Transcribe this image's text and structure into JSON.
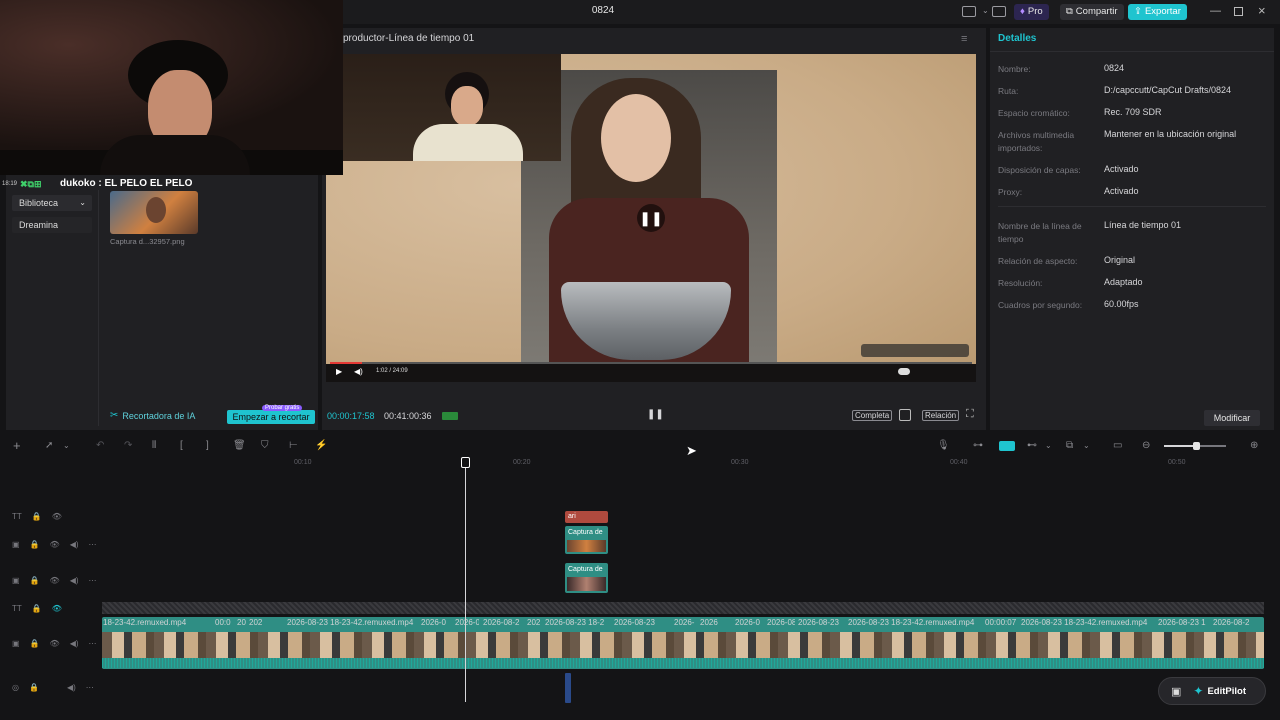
{
  "window_title": "0824",
  "top_actions": {
    "pro": "Pro",
    "share": "Compartir",
    "export": "Exportar"
  },
  "viewer": {
    "title": "productor-Línea de tiempo 01",
    "current_time": "00:00:17:58",
    "total_time": "00:41:00:36",
    "embedded_time": "1:02 / 24:09",
    "buttons": {
      "full": "Completa",
      "ratio": "Relación"
    }
  },
  "webcam_overlay": {
    "chat": "dukoko : EL PELO EL PELO",
    "time": "18:19"
  },
  "left_panel": {
    "nav": [
      "Biblioteca",
      "Dreamina"
    ],
    "media_caption": "Captura d...32957.png",
    "ai_cropper": "Recortadora de IA",
    "start_crop": "Empezar a recortar",
    "free_badge": "Probar gratis"
  },
  "details": {
    "tab": "Detalles",
    "rows": [
      {
        "label": "Nombre:",
        "value": "0824"
      },
      {
        "label": "Ruta:",
        "value": "D:/capccutt/CapCut Drafts/0824"
      },
      {
        "label": "Espacio cromático:",
        "value": "Rec. 709 SDR"
      },
      {
        "label": "Archivos multimedia importados:",
        "value": "Mantener en la ubicación original"
      },
      {
        "label": "Disposición de capas:",
        "value": "Activado"
      },
      {
        "label": "Proxy:",
        "value": "Activado"
      },
      {
        "label": "Nombre de la línea de tiempo",
        "value": "Línea de tiempo 01"
      },
      {
        "label": "Relación de aspecto:",
        "value": "Original"
      },
      {
        "label": "Resolución:",
        "value": "Adaptado"
      },
      {
        "label": "Cuadros por segundo:",
        "value": "60.00fps"
      }
    ],
    "modify": "Modificar"
  },
  "timeline": {
    "ticks": [
      "00:10",
      "00:20",
      "00:30",
      "00:40",
      "00:50"
    ],
    "small_clips": {
      "text": "ari",
      "capture1": "Captura de",
      "capture2": "Captura de"
    },
    "main_clip_labels": [
      "18-23-42.remuxed.mp4",
      "00:0",
      "20",
      "202",
      "2026-08-23 18-23-42.remuxed.mp4",
      "2026-0",
      "2026-0",
      "2026-08-2",
      "202",
      "2026-08-23 18-2",
      "2026-08-23",
      "2026-",
      "2026",
      "2026-0",
      "2026-08",
      "2026-08-23",
      "2026-08-23 18-23-42.remuxed.mp4",
      "00:00:07",
      "2026-08-23 18-23-42.remuxed.mp4",
      "2026-08-23 1",
      "2026-08-2"
    ],
    "editpilot": "EditPilot"
  },
  "colors": {
    "accent": "#1fc4cf",
    "clip": "#2f8e84",
    "text_clip": "#b04a3e",
    "bg": "#141416"
  }
}
